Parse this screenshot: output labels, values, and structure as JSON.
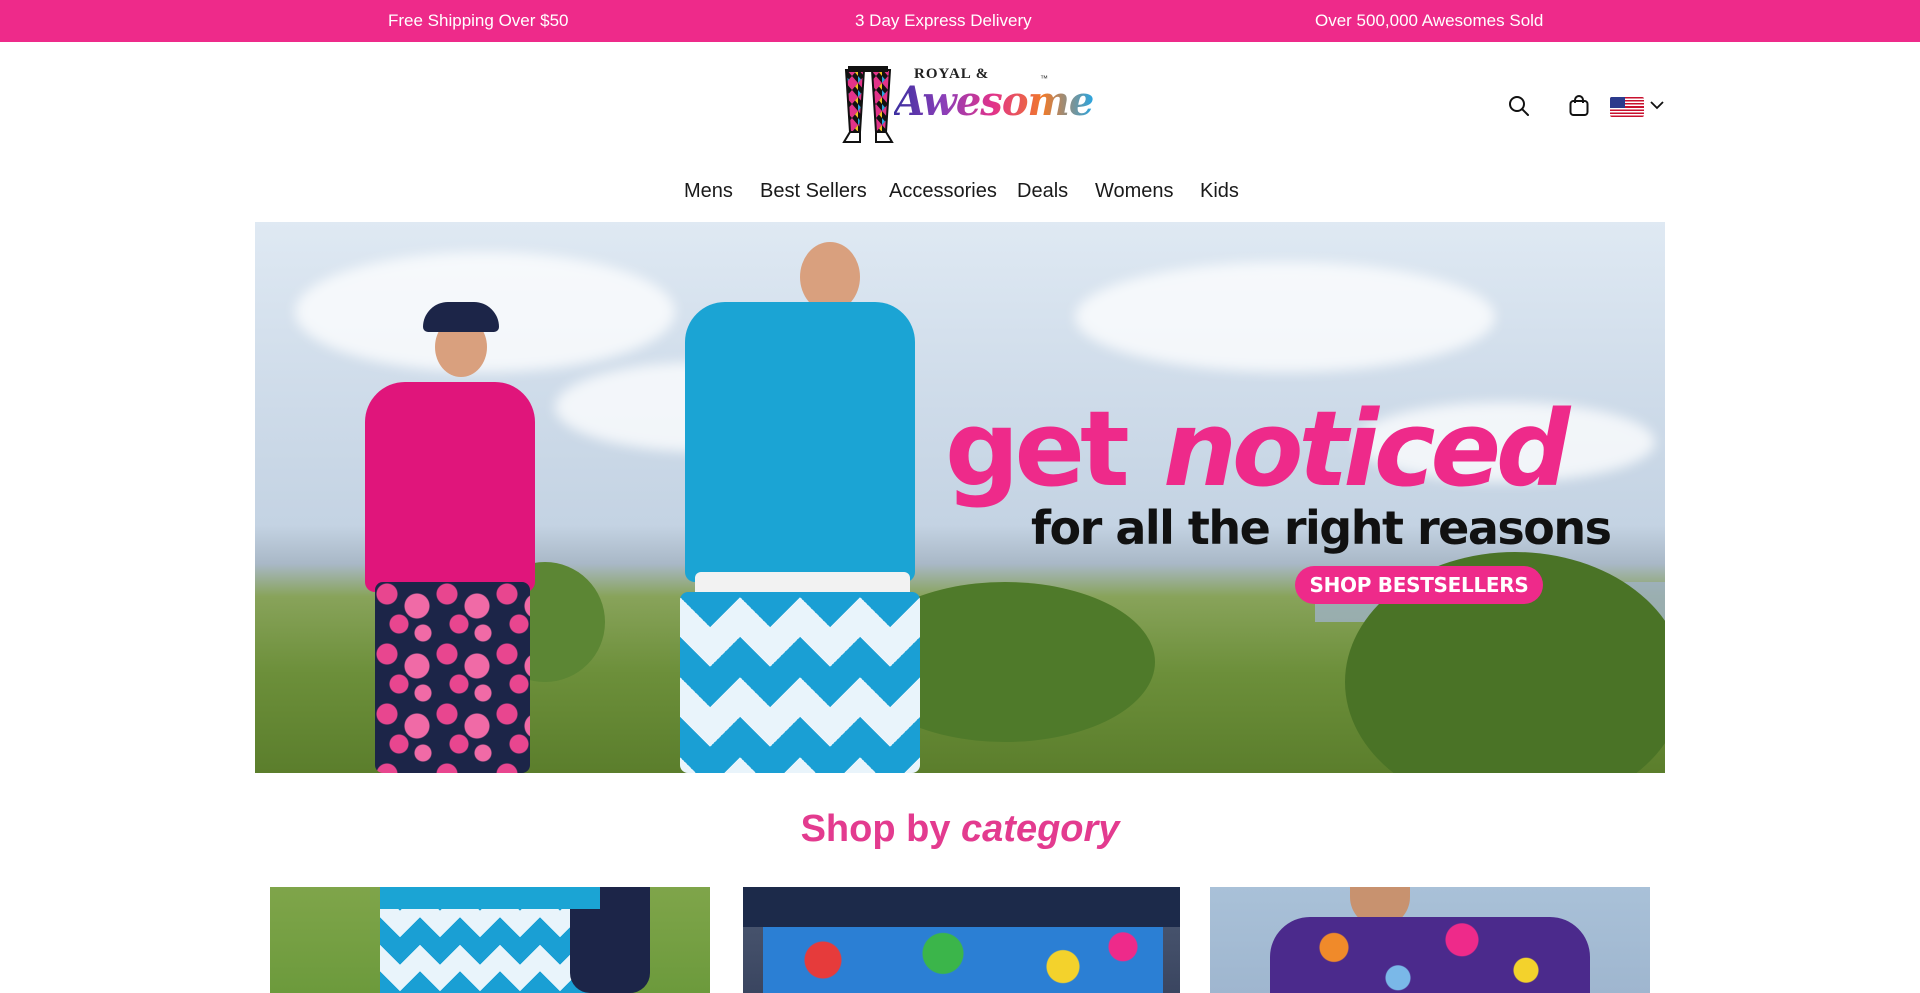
{
  "announcement_bar": {
    "messages": [
      "Free Shipping Over $50",
      "3 Day Express Delivery",
      "Over 500,000 Awesomes Sold"
    ]
  },
  "header": {
    "logo": {
      "line1": "ROYAL &",
      "line2": "Awesome",
      "tm": "™"
    },
    "icons": [
      "search-icon",
      "cart-icon",
      "us-flag-icon",
      "chevron-down-icon"
    ]
  },
  "nav": {
    "items": [
      "Mens",
      "Best Sellers",
      "Accessories",
      "Deals",
      "Womens",
      "Kids"
    ]
  },
  "hero": {
    "headline_part1": "get",
    "headline_part2": "noticed",
    "subheadline": "for all the right reasons",
    "cta_label": "SHOP BESTSELLERS"
  },
  "section": {
    "title_plain": "Shop by",
    "title_emph": "category"
  },
  "colors": {
    "brand_pink": "#ee2a8a",
    "section_title": "#e33b8f"
  }
}
